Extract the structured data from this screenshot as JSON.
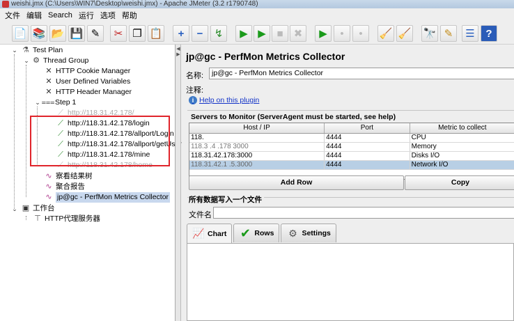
{
  "window": {
    "title": "weishi.jmx (C:\\Users\\WIN7\\Desktop\\weishi.jmx) - Apache JMeter (3.2 r1790748)"
  },
  "menu": [
    "文件",
    "编辑",
    "Search",
    "运行",
    "选项",
    "帮助"
  ],
  "toolbar": {
    "icons": [
      "new-icon",
      "templates-icon",
      "open-icon",
      "save-icon",
      "save-as-icon",
      "cut-icon",
      "copy-icon",
      "paste-icon",
      "expand-icon",
      "collapse-icon",
      "toggle-icon",
      "start-icon",
      "start-no-pause-icon",
      "stop-icon",
      "shutdown-icon",
      "remote-start-icon",
      "remote-stop-icon",
      "remote-shutdown-icon",
      "clear-icon",
      "clear-all-icon",
      "search-icon",
      "reset-search-icon",
      "function-helper-icon",
      "help-icon"
    ],
    "glyphs": [
      "📄",
      "📚",
      "📂",
      "💾",
      "✎",
      "✂",
      "❐",
      "📋",
      "+",
      "−",
      "↯",
      "▶",
      "▶",
      "■",
      "✖",
      "▶",
      "•",
      "•",
      "🧹",
      "🧹",
      "🔭",
      "✎",
      "☰",
      "?"
    ]
  },
  "tree": {
    "test_plan": "Test Plan",
    "thread_group": "Thread Group",
    "cookie_manager": "HTTP Cookie Manager",
    "user_vars": "User Defined Variables",
    "header_manager": "HTTP Header Manager",
    "step": "Step 1",
    "req0": "http://118.31.42.178/",
    "req1": "http://118.31.42.178/login",
    "req2": "http://118.31.42.178/allport/Login",
    "req3": "http://118.31.42.178/allport/getUser",
    "req4": "http://118.31.42.178/mine",
    "req5": "http://118.31.42.178/home",
    "listener1": "察看结果树",
    "listener2": "聚合报告",
    "perfmon": "jp@gc - PerfMon Metrics Collector",
    "workbench": "工作台",
    "proxy": "HTTP代理服务器"
  },
  "main": {
    "title": "jp@gc - PerfMon Metrics Collector",
    "name_label": "名称:",
    "name_value": "jp@gc - PerfMon Metrics Collector",
    "comments_label": "注释:",
    "help_link": "Help on this plugin",
    "servers_title": "Servers to Monitor (ServerAgent must be started, see help)",
    "columns": [
      "Host / IP",
      "Port",
      "Metric to collect"
    ],
    "rows": [
      {
        "host": "118.",
        "port": "4444",
        "metric": "CPU"
      },
      {
        "host": "118.3 .4 .178 3000",
        "port": "4444",
        "metric": "Memory"
      },
      {
        "host": "118.31.42.178:3000",
        "port": "4444",
        "metric": "Disks I/O"
      },
      {
        "host": "118.31.42.1 .5.3000",
        "port": "4444",
        "metric": "Network I/O"
      }
    ],
    "add_row": "Add Row",
    "copy_row": "Copy",
    "write_all_title": "所有数据写入一个文件",
    "filename_label": "文件名",
    "tabs": [
      "Chart",
      "Rows",
      "Settings"
    ]
  }
}
